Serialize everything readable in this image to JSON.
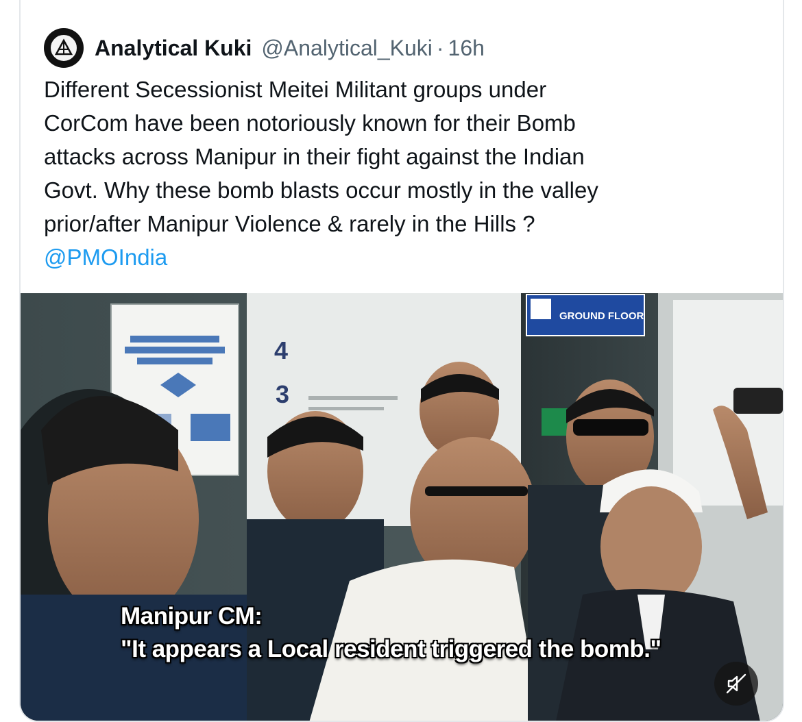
{
  "tweet": {
    "author_name": "Analytical Kuki",
    "handle": "@Analytical_Kuki",
    "separator": "·",
    "time": "16h",
    "text_lines": [
      "Different Secessionist Meitei Militant groups under",
      "CorCom have been notoriously known for their Bomb",
      "attacks across Manipur in their fight against the Indian",
      "Govt. Why these bomb blasts occur mostly in the valley",
      "prior/after Manipur Violence & rarely in the Hills ?"
    ],
    "mention": "@PMOIndia"
  },
  "video": {
    "caption_line1": "Manipur CM:",
    "caption_line2": "\"It appears a Local resident triggered the bomb.\"",
    "sign_text": "GROUND FLOOR",
    "floor_numbers": [
      "4",
      "3"
    ],
    "mute_icon": "speaker-muted-icon"
  },
  "colors": {
    "text": "#0f1419",
    "secondary": "#536471",
    "link": "#1d9bf0",
    "border": "#e4e7ea"
  }
}
